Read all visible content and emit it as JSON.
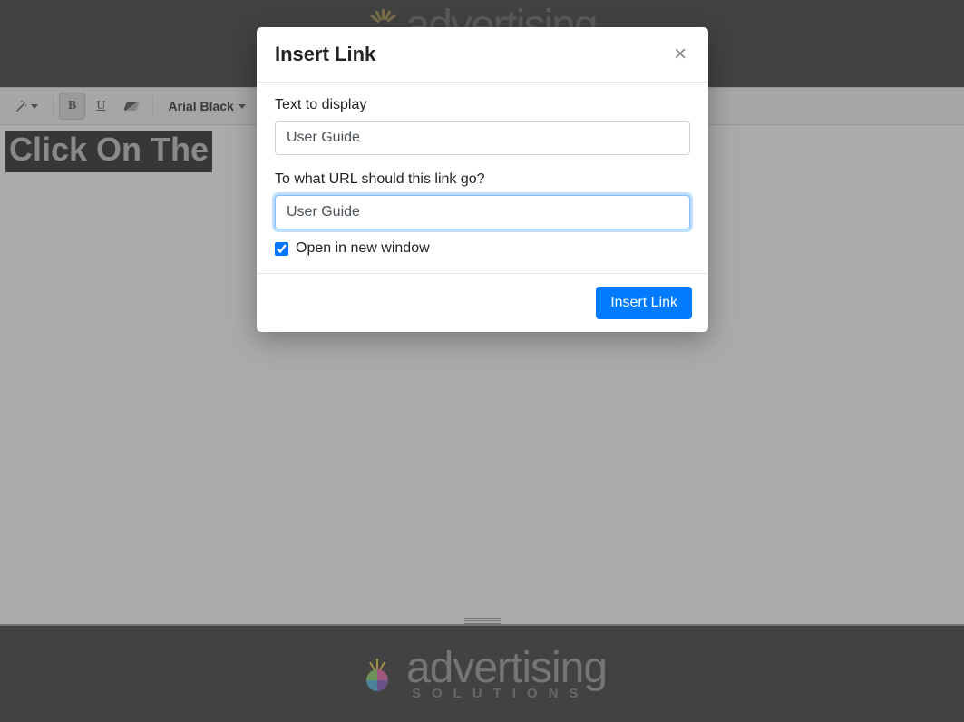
{
  "toolbar": {
    "bold_label": "B",
    "underline_label": "U",
    "font_family": "Arial Black"
  },
  "editor": {
    "visible_text": "Click On The"
  },
  "modal": {
    "title": "Insert Link",
    "text_label": "Text to display",
    "text_value": "User Guide",
    "url_label": "To what URL should this link go?",
    "url_value": "User Guide",
    "new_window_label": "Open in new window",
    "new_window_checked": true,
    "submit_label": "Insert Link"
  },
  "branding": {
    "main": "advertising",
    "sub": "SOLUTIONS"
  }
}
